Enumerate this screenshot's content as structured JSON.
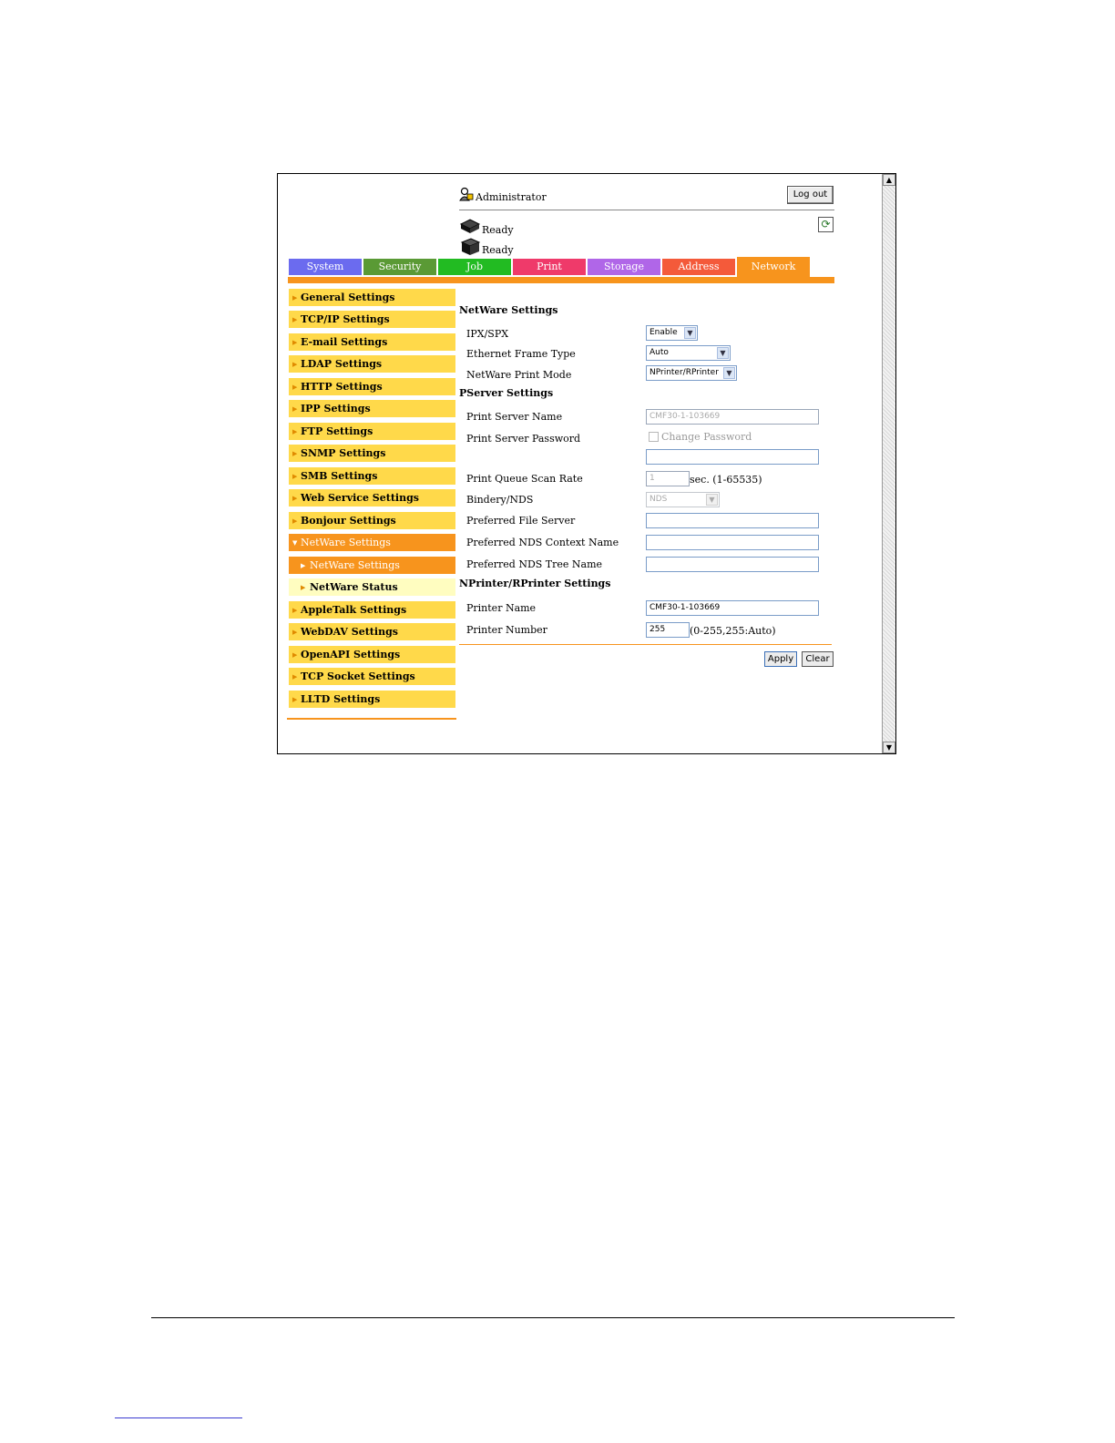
{
  "header": {
    "user_label": "Administrator",
    "logout_label": "Log out",
    "status": [
      "Ready",
      "Ready"
    ]
  },
  "tabs": [
    {
      "label": "System",
      "color": "#6b6bef"
    },
    {
      "label": "Security",
      "color": "#5a9a35"
    },
    {
      "label": "Job",
      "color": "#22bb22"
    },
    {
      "label": "Print",
      "color": "#ef3a6a"
    },
    {
      "label": "Storage",
      "color": "#b066e8"
    },
    {
      "label": "Address",
      "color": "#f45a3a"
    },
    {
      "label": "Network",
      "color": "#f7941d",
      "active": true
    }
  ],
  "sidebar": {
    "items": [
      {
        "label": "General Settings"
      },
      {
        "label": "TCP/IP Settings"
      },
      {
        "label": "E-mail Settings"
      },
      {
        "label": "LDAP Settings"
      },
      {
        "label": "HTTP Settings"
      },
      {
        "label": "IPP Settings"
      },
      {
        "label": "FTP Settings"
      },
      {
        "label": "SNMP Settings"
      },
      {
        "label": "SMB Settings"
      },
      {
        "label": "Web Service Settings"
      },
      {
        "label": "Bonjour Settings"
      },
      {
        "label": "NetWare Settings",
        "state": "open"
      },
      {
        "label": "NetWare Settings",
        "state": "sub-active"
      },
      {
        "label": "NetWare Status",
        "state": "sub"
      },
      {
        "label": "AppleTalk Settings"
      },
      {
        "label": "WebDAV Settings"
      },
      {
        "label": "OpenAPI Settings"
      },
      {
        "label": "TCP Socket Settings"
      },
      {
        "label": "LLTD Settings"
      }
    ]
  },
  "form": {
    "netware_title": "NetWare Settings",
    "ipx_label": "IPX/SPX",
    "ipx_value": "Enable",
    "frame_label": "Ethernet Frame Type",
    "frame_value": "Auto",
    "mode_label": "NetWare Print Mode",
    "mode_value": "NPrinter/RPrinter",
    "pserver_title": "PServer Settings",
    "ps_name_label": "Print Server Name",
    "ps_name_value": "CMF30-1-103669",
    "ps_password_label": "Print Server Password",
    "change_password_label": "Change Password",
    "scan_rate_label": "Print Queue Scan Rate",
    "scan_rate_value": "1",
    "scan_rate_suffix": "sec. (1-65535)",
    "bindery_label": "Bindery/NDS",
    "bindery_value": "NDS",
    "file_server_label": "Preferred File Server",
    "context_label": "Preferred NDS Context Name",
    "tree_label": "Preferred NDS Tree Name",
    "nprinter_title": "NPrinter/RPrinter Settings",
    "printer_name_label": "Printer Name",
    "printer_name_value": "CMF30-1-103669",
    "printer_number_label": "Printer Number",
    "printer_number_value": "255",
    "printer_number_suffix": "(0-255,255:Auto)",
    "apply_label": "Apply",
    "clear_label": "Clear"
  },
  "accent_color": "#f7941d",
  "sidebar_color": "#ffd94a"
}
